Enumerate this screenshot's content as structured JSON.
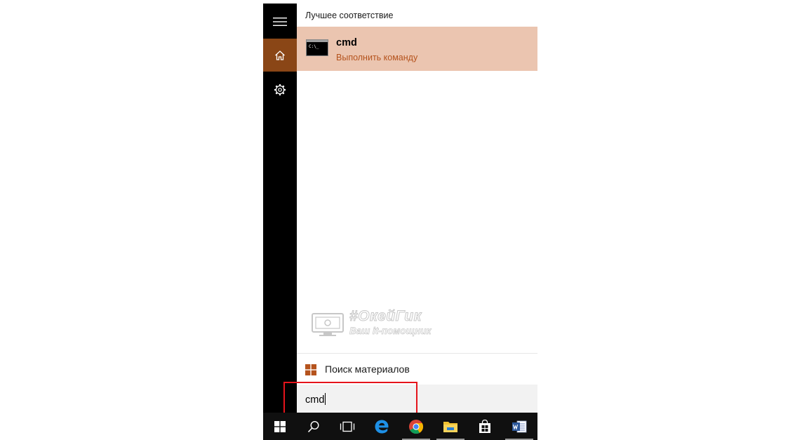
{
  "best_match": {
    "header": "Лучшее соответствие",
    "title": "cmd",
    "subtitle": "Выполнить команду",
    "icon": "cmd-icon",
    "icon_text": "C:\\_"
  },
  "rail": {
    "items": [
      {
        "name": "hamburger-menu-icon"
      },
      {
        "name": "home-icon",
        "active": true
      },
      {
        "name": "gear-icon"
      }
    ]
  },
  "watermark": {
    "title": "#ОкейГик",
    "subtitle": "Ваш it-помощник"
  },
  "search_materials": {
    "label": "Поиск материалов",
    "icon": "windows-logo-icon"
  },
  "search": {
    "value": "cmd"
  },
  "taskbar": {
    "items": [
      "windows-start-icon",
      "search-icon",
      "task-view-icon",
      "edge-icon",
      "chrome-icon",
      "file-explorer-icon",
      "store-icon",
      "word-icon"
    ]
  },
  "colors": {
    "accent": "#8a4616",
    "selection": "#ebc5b0",
    "subtitle": "#b5531d",
    "highlight": "#e5141b"
  }
}
